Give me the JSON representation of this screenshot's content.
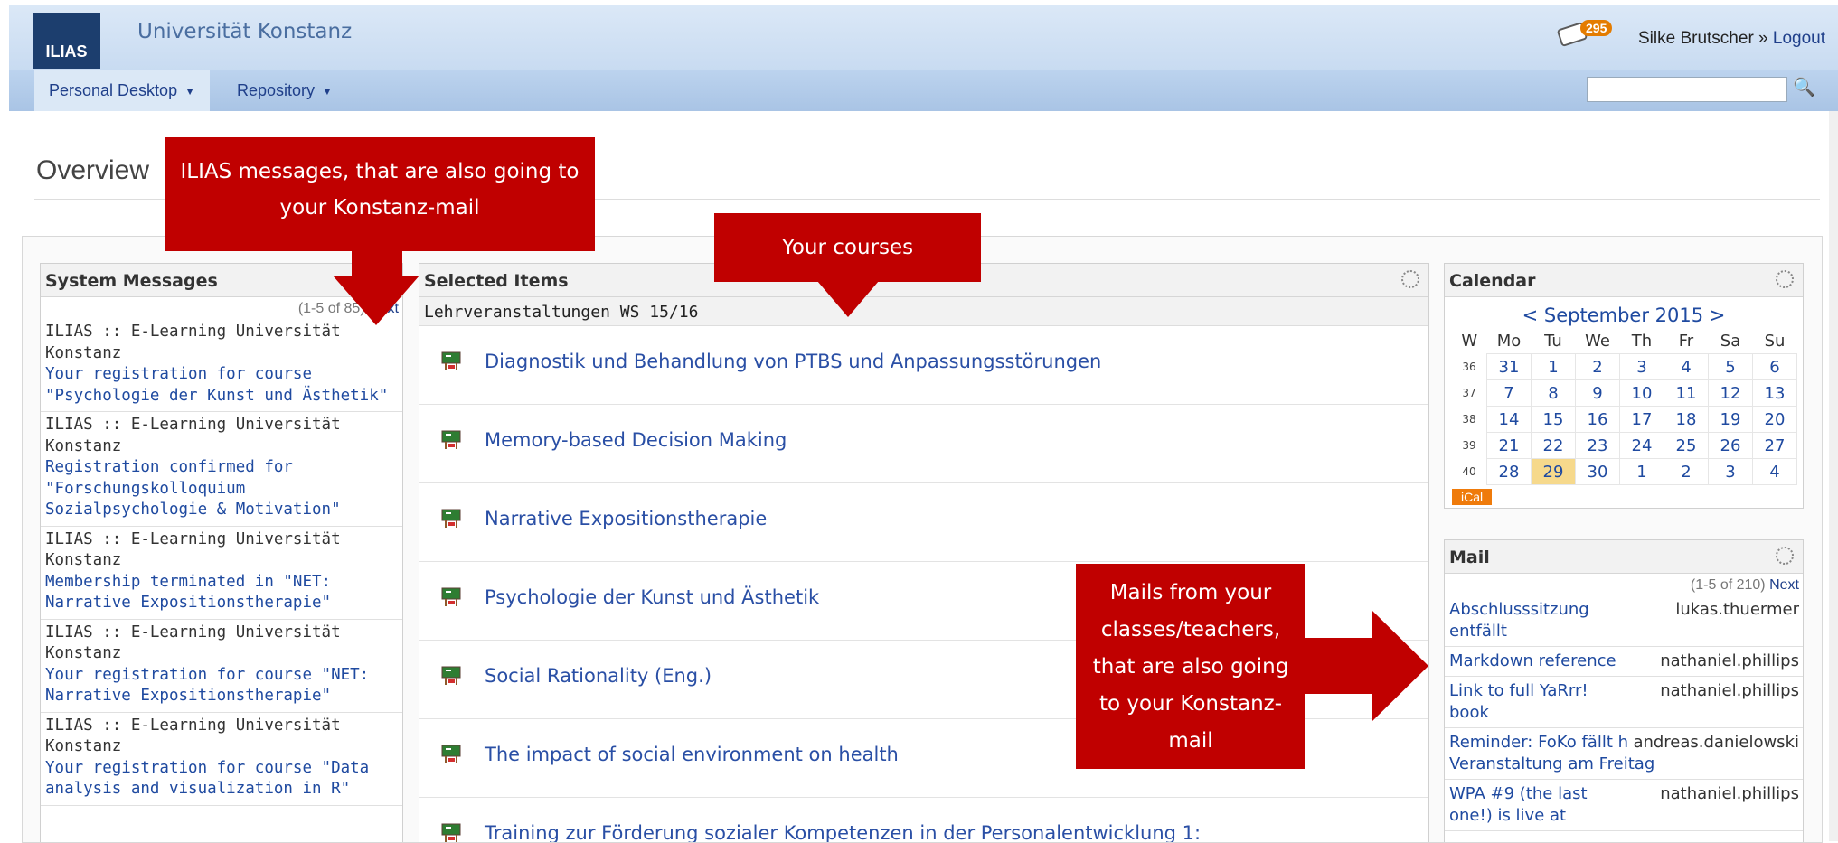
{
  "header": {
    "logo_text": "ILIAS",
    "institution": "Universität Konstanz",
    "mail_badge": "295",
    "user_name": "Silke Brutscher",
    "user_sep": " » ",
    "logout_label": "Logout"
  },
  "nav": {
    "tabs": [
      {
        "label": "Personal Desktop"
      },
      {
        "label": "Repository"
      }
    ],
    "search_placeholder": ""
  },
  "page_title": "Overview",
  "system_messages": {
    "title": "System Messages",
    "pager": "(1-5 of 85)",
    "next": "Next",
    "items": [
      {
        "from": "ILIAS :: E-Learning Universität Konstanz",
        "subject": "Your registration for course \"Psychologie der Kunst und Ästhetik\""
      },
      {
        "from": "ILIAS :: E-Learning Universität Konstanz",
        "subject": "Registration confirmed for \"Forschungskolloquium Sozialpsychologie & Motivation\""
      },
      {
        "from": "ILIAS :: E-Learning Universität Konstanz",
        "subject": "Membership terminated in \"NET: Narrative Expositionstherapie\""
      },
      {
        "from": "ILIAS :: E-Learning Universität Konstanz",
        "subject": "Your registration for course \"NET: Narrative Expositionstherapie\""
      },
      {
        "from": "ILIAS :: E-Learning Universität Konstanz",
        "subject": "Your registration for course \"Data analysis and visualization in R\""
      }
    ]
  },
  "selected_items": {
    "title": "Selected Items",
    "group": "Lehrveranstaltungen WS 15/16",
    "courses": [
      "Diagnostik und Behandlung von PTBS und Anpassungsstörungen",
      "Memory-based Decision Making",
      "Narrative Expositionstherapie",
      "Psychologie der Kunst und Ästhetik",
      "Social Rationality (Eng.)",
      "The impact of social environment on health",
      "Training zur Förderung sozialer Kompetenzen in der Personalentwicklung 1:"
    ]
  },
  "calendar": {
    "title": "Calendar",
    "month_label": "< September 2015 >",
    "headers": [
      "W",
      "Mo",
      "Tu",
      "We",
      "Th",
      "Fr",
      "Sa",
      "Su"
    ],
    "weeks": [
      {
        "wk": "36",
        "days": [
          "31",
          "1",
          "2",
          "3",
          "4",
          "5",
          "6"
        ]
      },
      {
        "wk": "37",
        "days": [
          "7",
          "8",
          "9",
          "10",
          "11",
          "12",
          "13"
        ]
      },
      {
        "wk": "38",
        "days": [
          "14",
          "15",
          "16",
          "17",
          "18",
          "19",
          "20"
        ]
      },
      {
        "wk": "39",
        "days": [
          "21",
          "22",
          "23",
          "24",
          "25",
          "26",
          "27"
        ]
      },
      {
        "wk": "40",
        "days": [
          "28",
          "29",
          "30",
          "1",
          "2",
          "3",
          "4"
        ]
      }
    ],
    "today": "29",
    "ical_label": "iCal"
  },
  "mail": {
    "title": "Mail",
    "pager": "(1-5 of 210)",
    "next": "Next",
    "items": [
      {
        "subject": "Abschlusssitzung entfällt",
        "from": "lukas.thuermer"
      },
      {
        "subject": "Markdown reference",
        "from": "nathaniel.phillips"
      },
      {
        "subject": "Link to full YaRrr! book",
        "from": "nathaniel.phillips"
      },
      {
        "subject": "Reminder: FoKo fällt heute aus, Veranstaltung am Freitag",
        "from": "andreas.danielowski"
      },
      {
        "subject": "WPA #9 (the last one!) is live at",
        "from": "nathaniel.phillips"
      }
    ]
  },
  "callouts": {
    "messages": "ILIAS messages, that are also going to your Konstanz-mail",
    "courses": "Your courses",
    "mails": "Mails from your classes/teachers, that are also going to your Konstanz-mail"
  },
  "colors": {
    "callout": "#c00000",
    "link": "#1f4aa0",
    "header": "#c8dbf1",
    "badge": "#e47c00"
  }
}
